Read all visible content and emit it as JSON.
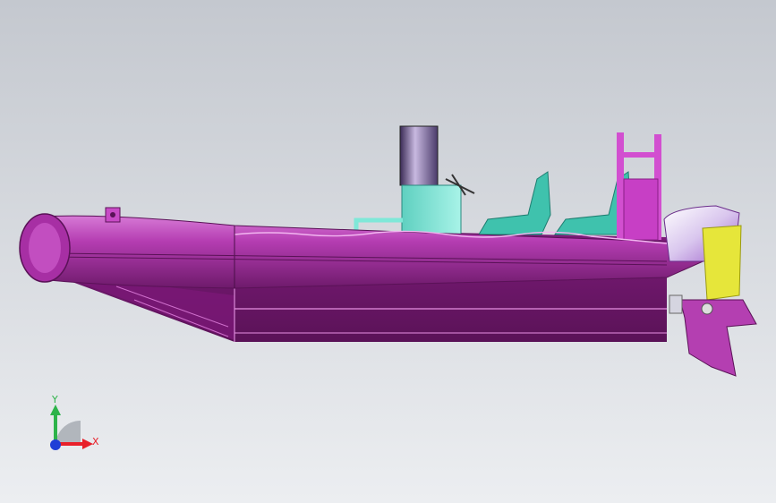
{
  "viewport": {
    "background_top": "#c8ccd3",
    "background_bottom": "#e9ebee"
  },
  "model": {
    "hull_color": "#8a1f86",
    "tube_color": "#b23ab0",
    "console_color": "#7fe8d8",
    "engine_cowl_color": "#e8d8f0",
    "engine_bracket_color": "#e6e63a"
  },
  "triad": {
    "x_label": "X",
    "y_label": "Y",
    "x_color": "#e8202a",
    "y_color": "#2db34a",
    "z_color": "#1f3fd6"
  }
}
